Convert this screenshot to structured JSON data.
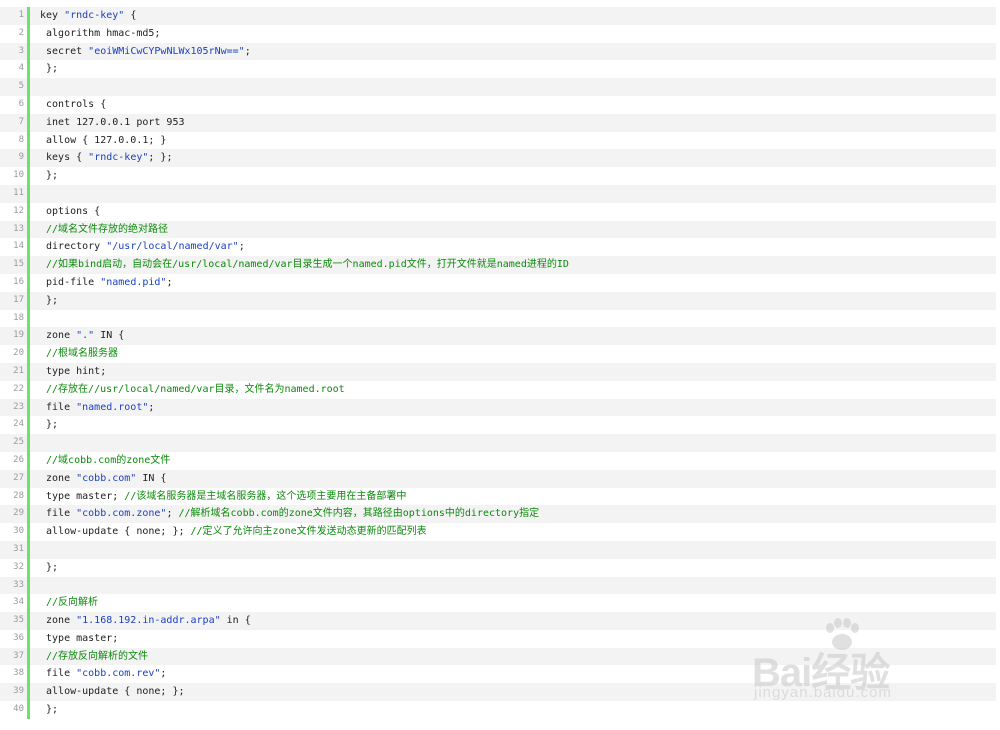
{
  "code": {
    "lines": [
      {
        "num": "1",
        "tokens": [
          {
            "t": "key ",
            "c": "plain"
          },
          {
            "t": "\"rndc-key\"",
            "c": "string"
          },
          {
            "t": " {",
            "c": "plain"
          }
        ]
      },
      {
        "num": "2",
        "tokens": [
          {
            "t": " algorithm hmac-md5;",
            "c": "plain"
          }
        ]
      },
      {
        "num": "3",
        "tokens": [
          {
            "t": " secret ",
            "c": "plain"
          },
          {
            "t": "\"eoiWMiCwCYPwNLWx105rNw==\"",
            "c": "string"
          },
          {
            "t": ";",
            "c": "plain"
          }
        ]
      },
      {
        "num": "4",
        "tokens": [
          {
            "t": " };",
            "c": "plain"
          }
        ]
      },
      {
        "num": "5",
        "tokens": []
      },
      {
        "num": "6",
        "tokens": [
          {
            "t": " controls {",
            "c": "plain"
          }
        ]
      },
      {
        "num": "7",
        "tokens": [
          {
            "t": " inet 127.0.0.1 port 953",
            "c": "plain"
          }
        ]
      },
      {
        "num": "8",
        "tokens": [
          {
            "t": " allow { 127.0.0.1; }",
            "c": "plain"
          }
        ]
      },
      {
        "num": "9",
        "tokens": [
          {
            "t": " keys { ",
            "c": "plain"
          },
          {
            "t": "\"rndc-key\"",
            "c": "string"
          },
          {
            "t": "; };",
            "c": "plain"
          }
        ]
      },
      {
        "num": "10",
        "tokens": [
          {
            "t": " };",
            "c": "plain"
          }
        ]
      },
      {
        "num": "11",
        "tokens": []
      },
      {
        "num": "12",
        "tokens": [
          {
            "t": " options {",
            "c": "plain"
          }
        ]
      },
      {
        "num": "13",
        "tokens": [
          {
            "t": " //域名文件存放的绝对路径",
            "c": "comment"
          }
        ]
      },
      {
        "num": "14",
        "tokens": [
          {
            "t": " directory ",
            "c": "plain"
          },
          {
            "t": "\"/usr/local/named/var\"",
            "c": "string"
          },
          {
            "t": ";",
            "c": "plain"
          }
        ]
      },
      {
        "num": "15",
        "tokens": [
          {
            "t": " //如果bind启动，自动会在/usr/local/named/var目录生成一个named.pid文件，打开文件就是named进程的ID",
            "c": "comment"
          }
        ]
      },
      {
        "num": "16",
        "tokens": [
          {
            "t": " pid-file ",
            "c": "plain"
          },
          {
            "t": "\"named.pid\"",
            "c": "string"
          },
          {
            "t": ";",
            "c": "plain"
          }
        ]
      },
      {
        "num": "17",
        "tokens": [
          {
            "t": " };",
            "c": "plain"
          }
        ]
      },
      {
        "num": "18",
        "tokens": []
      },
      {
        "num": "19",
        "tokens": [
          {
            "t": " zone ",
            "c": "plain"
          },
          {
            "t": "\".\"",
            "c": "string"
          },
          {
            "t": " IN {",
            "c": "plain"
          }
        ]
      },
      {
        "num": "20",
        "tokens": [
          {
            "t": " //根域名服务器",
            "c": "comment"
          }
        ]
      },
      {
        "num": "21",
        "tokens": [
          {
            "t": " type hint;",
            "c": "plain"
          }
        ]
      },
      {
        "num": "22",
        "tokens": [
          {
            "t": " //存放在//usr/local/named/var目录，文件名为named.root",
            "c": "comment"
          }
        ]
      },
      {
        "num": "23",
        "tokens": [
          {
            "t": " file ",
            "c": "plain"
          },
          {
            "t": "\"named.root\"",
            "c": "string"
          },
          {
            "t": ";",
            "c": "plain"
          }
        ]
      },
      {
        "num": "24",
        "tokens": [
          {
            "t": " };",
            "c": "plain"
          }
        ]
      },
      {
        "num": "25",
        "tokens": []
      },
      {
        "num": "26",
        "tokens": [
          {
            "t": " //域cobb.com的zone文件",
            "c": "comment"
          }
        ]
      },
      {
        "num": "27",
        "tokens": [
          {
            "t": " zone ",
            "c": "plain"
          },
          {
            "t": "\"cobb.com\"",
            "c": "string"
          },
          {
            "t": " IN {",
            "c": "plain"
          }
        ]
      },
      {
        "num": "28",
        "tokens": [
          {
            "t": " type master; ",
            "c": "plain"
          },
          {
            "t": "//该域名服务器是主域名服务器，这个选项主要用在主备部署中",
            "c": "comment"
          }
        ]
      },
      {
        "num": "29",
        "tokens": [
          {
            "t": " file ",
            "c": "plain"
          },
          {
            "t": "\"cobb.com.zone\"",
            "c": "string"
          },
          {
            "t": "; ",
            "c": "plain"
          },
          {
            "t": "//解析域名cobb.com的zone文件内容，其路径由options中的directory指定",
            "c": "comment"
          }
        ]
      },
      {
        "num": "30",
        "tokens": [
          {
            "t": " allow-update { none; }; ",
            "c": "plain"
          },
          {
            "t": "//定义了允许向主zone文件发送动态更新的匹配列表",
            "c": "comment"
          }
        ]
      },
      {
        "num": "31",
        "tokens": []
      },
      {
        "num": "32",
        "tokens": [
          {
            "t": " };",
            "c": "plain"
          }
        ]
      },
      {
        "num": "33",
        "tokens": []
      },
      {
        "num": "34",
        "tokens": [
          {
            "t": " //反向解析",
            "c": "comment"
          }
        ]
      },
      {
        "num": "35",
        "tokens": [
          {
            "t": " zone ",
            "c": "plain"
          },
          {
            "t": "\"1.168.192.in-addr.arpa\"",
            "c": "string"
          },
          {
            "t": " in {",
            "c": "plain"
          }
        ]
      },
      {
        "num": "36",
        "tokens": [
          {
            "t": " type master;",
            "c": "plain"
          }
        ]
      },
      {
        "num": "37",
        "tokens": [
          {
            "t": " //存放反向解析的文件",
            "c": "comment"
          }
        ]
      },
      {
        "num": "38",
        "tokens": [
          {
            "t": " file ",
            "c": "plain"
          },
          {
            "t": "\"cobb.com.rev\"",
            "c": "string"
          },
          {
            "t": ";",
            "c": "plain"
          }
        ]
      },
      {
        "num": "39",
        "tokens": [
          {
            "t": " allow-update { none; };",
            "c": "plain"
          }
        ]
      },
      {
        "num": "40",
        "tokens": [
          {
            "t": " };",
            "c": "plain"
          }
        ]
      }
    ]
  },
  "watermark": {
    "logo_text": "Bai经验",
    "url": "jingyan.baidu.com"
  },
  "colors": {
    "gutter_border": "#6ce26c",
    "string": "#1a41c4",
    "comment": "#0c8a0c",
    "odd_row": "#f3f3f3"
  }
}
